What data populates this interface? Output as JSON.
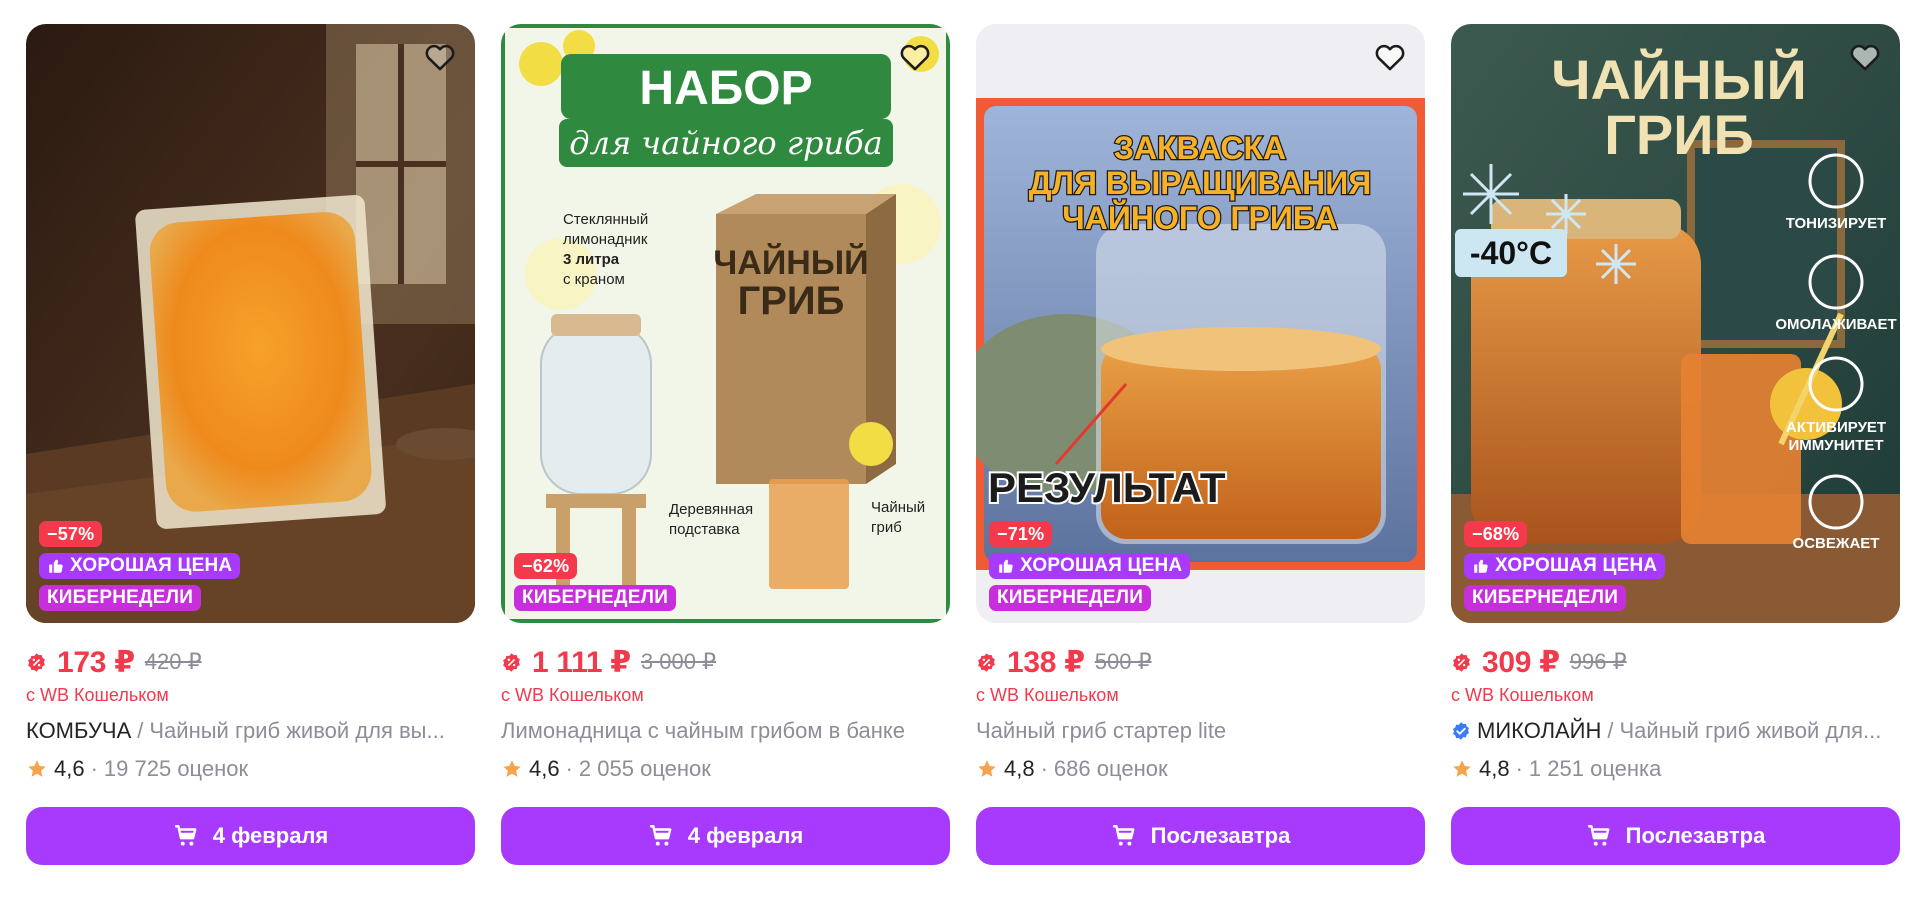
{
  "products": [
    {
      "discount": "−57%",
      "good_price": "ХОРОШАЯ ЦЕНА",
      "cyber": "КИБЕРНЕДЕЛИ",
      "price": "173 ₽",
      "old_price": "420 ₽",
      "wallet": "с WB Кошельком",
      "brand": "КОМБУЧА",
      "separator": "/",
      "name": "Чайный гриб живой для вы...",
      "rating": "4,6",
      "dot": "·",
      "reviews": "19 725 оценок",
      "delivery": "4 февраля"
    },
    {
      "discount": "−62%",
      "cyber": "КИБЕРНЕДЕЛИ",
      "price": "1 111 ₽",
      "old_price": "3 000 ₽",
      "wallet": "с WB Кошельком",
      "name": "Лимонадница с чайным грибом в банке",
      "rating": "4,6",
      "dot": "·",
      "reviews": "2 055 оценок",
      "delivery": "4 февраля",
      "image_text": {
        "set": "НАБОР",
        "set_sub": "для чайного гриба",
        "glass_lemon": [
          "Стеклянный",
          "лимонадник",
          "3 литра",
          "с краном"
        ],
        "box_title": [
          "ЧАЙНЫЙ",
          "ГРИБ"
        ],
        "stand": [
          "Деревянная",
          "подставка"
        ],
        "mushroom": [
          "Чайный",
          "гриб"
        ]
      }
    },
    {
      "discount": "−71%",
      "good_price": "ХОРОШАЯ ЦЕНА",
      "cyber": "КИБЕРНЕДЕЛИ",
      "price": "138 ₽",
      "old_price": "500 ₽",
      "wallet": "с WB Кошельком",
      "name": "Чайный гриб стартер lite",
      "rating": "4,8",
      "dot": "·",
      "reviews": "686 оценок",
      "delivery": "Послезавтра",
      "image_text": {
        "headline": [
          "ЗАКВАСКА",
          "ДЛЯ ВЫРАЩИВАНИЯ",
          "ЧАЙНОГО ГРИБА"
        ],
        "result": "РЕЗУЛЬТАТ"
      }
    },
    {
      "discount": "−68%",
      "good_price": "ХОРОШАЯ ЦЕНА",
      "cyber": "КИБЕРНЕДЕЛИ",
      "price": "309 ₽",
      "old_price": "996 ₽",
      "wallet": "с WB Кошельком",
      "brand": "МИКОЛАЙН",
      "separator": "/",
      "name": "Чайный гриб живой для...",
      "rating": "4,8",
      "dot": "·",
      "reviews": "1 251 оценка",
      "delivery": "Послезавтра",
      "image_text": {
        "headline": [
          "ЧАЙНЫЙ",
          "ГРИБ"
        ],
        "temp": "-40°C",
        "benefits": [
          "ТОНИЗИРУЕТ",
          "ОМОЛАЖИВАЕТ",
          "АКТИВИРУЕТ",
          "ИММУНИТЕТ",
          "ОСВЕЖАЕТ"
        ]
      }
    }
  ],
  "icons": {
    "favorite": "heart-icon",
    "wallet": "wallet-discount-icon",
    "rating": "star-icon",
    "cart": "cart-icon",
    "good_price": "thumbs-up-icon",
    "verified": "verified-badge-icon"
  },
  "colors": {
    "accent": "#a73afd",
    "price": "#f23a4c",
    "cyber": "#c82fdc",
    "muted": "#8d8d98",
    "star": "#f5a44b"
  }
}
